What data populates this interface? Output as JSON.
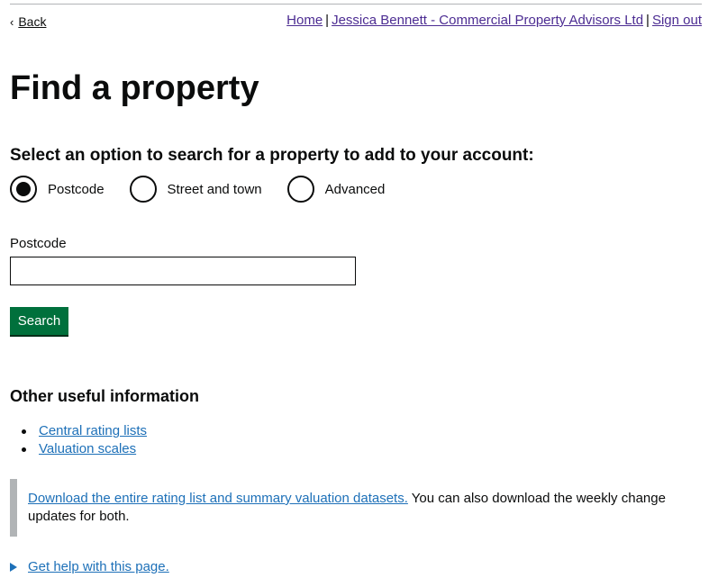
{
  "nav": {
    "back_label": "Back",
    "home_label": "Home",
    "account_label": "Jessica Bennett - Commercial Property Advisors Ltd",
    "signout_label": "Sign out",
    "separator": "|"
  },
  "page": {
    "title": "Find a property"
  },
  "search_options": {
    "legend": "Select an option to search for a property to add to your account:",
    "options": [
      {
        "label": "Postcode",
        "selected": true
      },
      {
        "label": "Street and town",
        "selected": false
      },
      {
        "label": "Advanced",
        "selected": false
      }
    ]
  },
  "postcode_field": {
    "label": "Postcode",
    "value": ""
  },
  "search_button": {
    "label": "Search"
  },
  "other_info": {
    "heading": "Other useful information",
    "links": [
      "Central rating lists",
      "Valuation scales"
    ]
  },
  "inset": {
    "link_text": "Download the entire rating list and summary valuation datasets.",
    "text": " You can also download the weekly change updates for both."
  },
  "help": {
    "label": "Get help with this page."
  },
  "colors": {
    "link": "#1d70b8",
    "visited_link": "#4c2c92",
    "button": "#00703c",
    "text": "#0b0c0c",
    "border": "#b1b4b6"
  }
}
